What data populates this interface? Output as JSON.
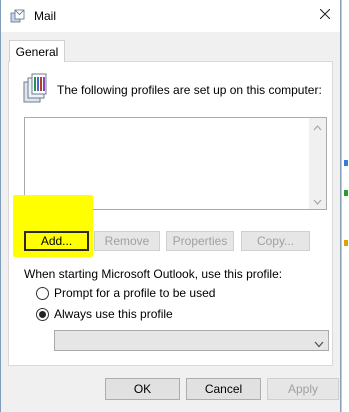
{
  "window": {
    "title": "Mail",
    "title_icon": "mail-profiles-icon",
    "close_icon": "close-icon"
  },
  "tabs": [
    {
      "label": "General"
    }
  ],
  "general": {
    "intro_text": "The following profiles are set up on this computer:",
    "profiles": [],
    "buttons": {
      "add": "Add...",
      "remove": "Remove",
      "properties": "Properties",
      "copy": "Copy..."
    },
    "startup_label": "When starting Microsoft Outlook, use this profile:",
    "options": [
      {
        "label": "Prompt for a profile to be used",
        "selected": false
      },
      {
        "label": "Always use this profile",
        "selected": true
      }
    ],
    "profile_select_value": ""
  },
  "footer": {
    "ok": "OK",
    "cancel": "Cancel",
    "apply": "Apply"
  },
  "colors": {
    "highlight": "#ffff00",
    "panel_bg": "#ffffff",
    "dialog_bg": "#f0f0f0",
    "disabled_text": "#a0a0a0"
  }
}
